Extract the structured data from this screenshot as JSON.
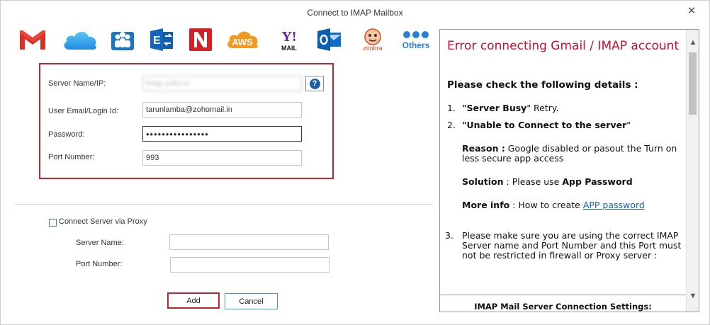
{
  "window": {
    "title": "Connect to IMAP Mailbox",
    "close_glyph": "✕"
  },
  "providers": [
    {
      "icon": "gmail-icon"
    },
    {
      "icon": "icloud-icon"
    },
    {
      "icon": "office-people-icon"
    },
    {
      "icon": "exchange-icon"
    },
    {
      "icon": "n-mail-icon"
    },
    {
      "icon": "aws-icon",
      "text": "AWS"
    },
    {
      "icon": "yahoo-mail-icon",
      "text": "Y!",
      "sub": "MAIL"
    },
    {
      "icon": "outlook-icon",
      "text": "O"
    },
    {
      "icon": "zimbra-icon",
      "text": "zimbra"
    },
    {
      "icon": "others-icon",
      "text": "Others"
    }
  ],
  "server": {
    "name_label": "Server Name/IP:",
    "name_value": "imap.zoho.in",
    "email_label": "User Email/Login Id:",
    "email_value": "tarunlamba@zohomail.in",
    "password_label": "Password:",
    "password_value": "••••••••••••••••",
    "port_label": "Port Number:",
    "port_value": "993",
    "help_glyph": "?"
  },
  "proxy": {
    "checkbox_label": "Connect Server via Proxy",
    "server_label": "Server Name:",
    "server_value": "",
    "port_label": "Port Number:",
    "port_value": ""
  },
  "buttons": {
    "add": "Add",
    "cancel": "Cancel"
  },
  "info": {
    "error_title": "Error connecting Gmail / IMAP account",
    "check_heading": "Please check the following details :",
    "item1_num": "1.",
    "item1_bold": "\"Server Busy",
    "item1_rest": "\" Retry.",
    "item2_num": "2.",
    "item2_bold": "\"Unable to Connect to the server",
    "item2_rest": "\"",
    "reason_label": "Reason :",
    "reason_text": " Google disabled or pasout the Turn on less secure app access",
    "solution_label": "Solution",
    "solution_text": " : Please use ",
    "solution_bold": "App Password",
    "more_label": "More info",
    "more_text": " : How to create ",
    "more_link": "APP password",
    "item3_num": "3.",
    "item3_text": "Please make sure you are using the correct IMAP Server name and Port Number and this Port must not be restricted in firewall or Proxy server :",
    "footer": "IMAP Mail Server Connection Settings:"
  },
  "colors": {
    "error_red": "#c8102e",
    "accent_red": "#c0262d",
    "link_blue": "#1a5fb4"
  }
}
